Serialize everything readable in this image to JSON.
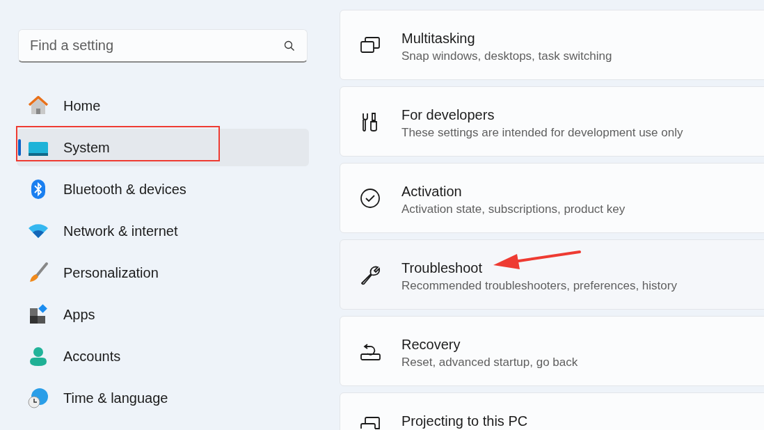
{
  "search": {
    "placeholder": "Find a setting"
  },
  "nav": [
    {
      "label": "Home",
      "selected": false,
      "highlighted": false
    },
    {
      "label": "System",
      "selected": true,
      "highlighted": true
    },
    {
      "label": "Bluetooth & devices",
      "selected": false,
      "highlighted": false
    },
    {
      "label": "Network & internet",
      "selected": false,
      "highlighted": false
    },
    {
      "label": "Personalization",
      "selected": false,
      "highlighted": false
    },
    {
      "label": "Apps",
      "selected": false,
      "highlighted": false
    },
    {
      "label": "Accounts",
      "selected": false,
      "highlighted": false
    },
    {
      "label": "Time & language",
      "selected": false,
      "highlighted": false
    }
  ],
  "cards": [
    {
      "title": "Multitasking",
      "subtitle": "Snap windows, desktops, task switching",
      "hovered": false,
      "pointed": false
    },
    {
      "title": "For developers",
      "subtitle": "These settings are intended for development use only",
      "hovered": false,
      "pointed": false
    },
    {
      "title": "Activation",
      "subtitle": "Activation state, subscriptions, product key",
      "hovered": false,
      "pointed": false
    },
    {
      "title": "Troubleshoot",
      "subtitle": "Recommended troubleshooters, preferences, history",
      "hovered": true,
      "pointed": true
    },
    {
      "title": "Recovery",
      "subtitle": "Reset, advanced startup, go back",
      "hovered": false,
      "pointed": false
    },
    {
      "title": "Projecting to this PC",
      "hovered": false,
      "pointed": false
    }
  ]
}
